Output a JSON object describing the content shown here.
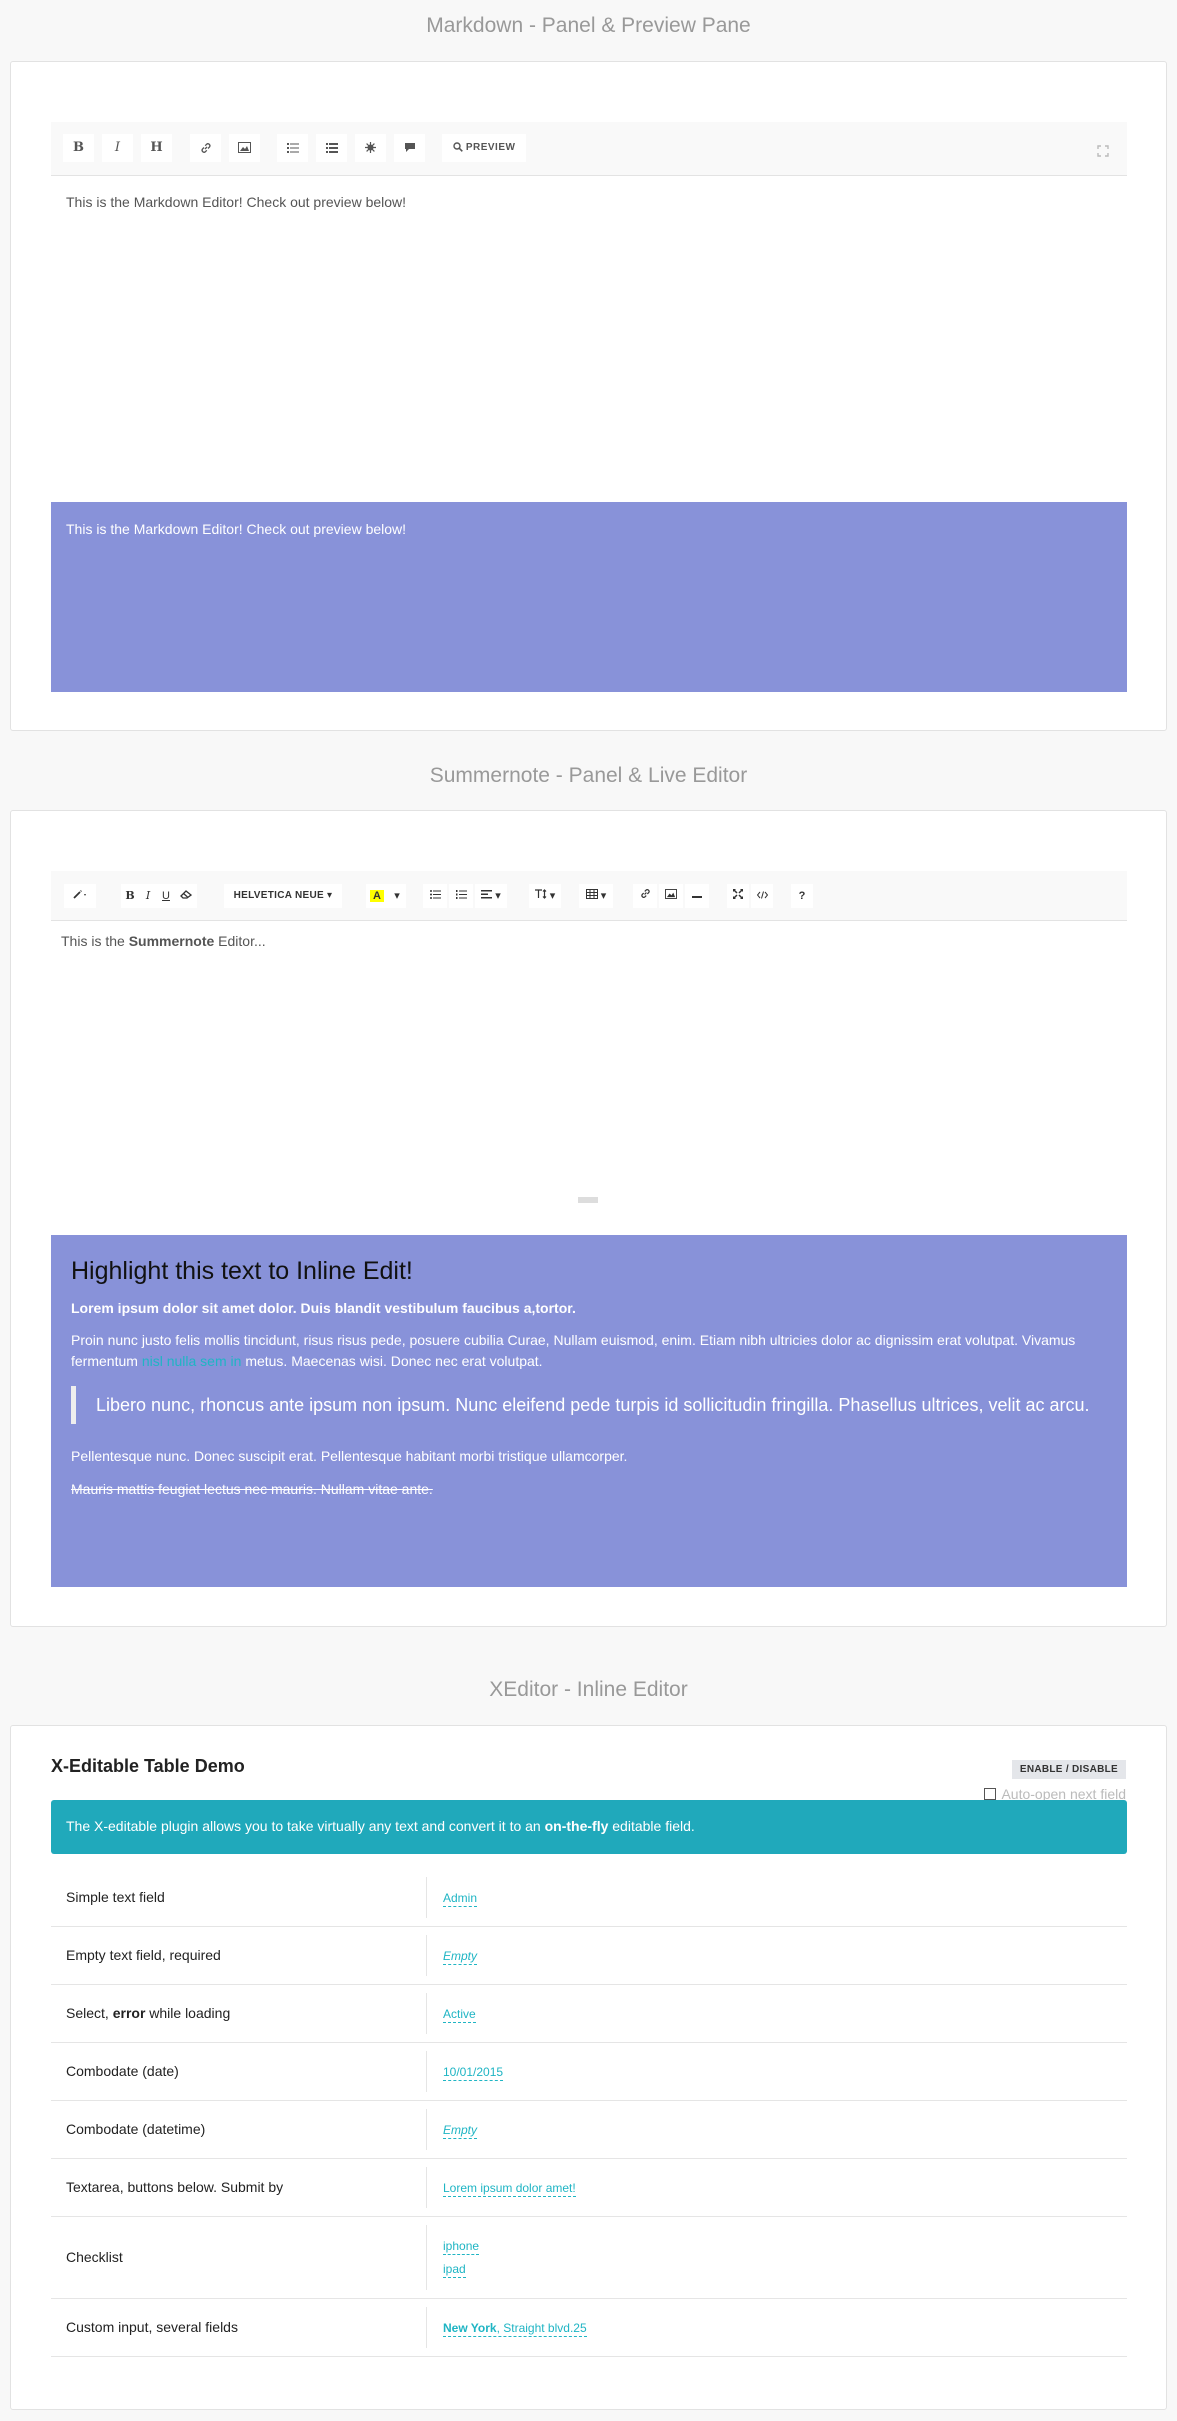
{
  "markdown": {
    "section_title": "Markdown - Panel & Preview Pane",
    "toolbar": {
      "bold": "B",
      "italic": "I",
      "heading": "H",
      "preview": "PREVIEW",
      "icons": [
        "link-icon",
        "image-icon",
        "unordered-list-icon",
        "ordered-list-icon",
        "code-icon",
        "quote-icon",
        "search-icon",
        "fullscreen-icon"
      ]
    },
    "editor_text": "This is the Markdown Editor! Check out preview below!",
    "preview_text": "This is the Markdown Editor! Check out preview below!",
    "preview_color": "#8892d9"
  },
  "summernote": {
    "section_title": "Summernote - Panel & Live Editor",
    "toolbar": {
      "font_name": "HELVETICA NEUE",
      "bold": "B",
      "italic": "I",
      "underline": "U",
      "color_letter": "A",
      "help": "?"
    },
    "editor_text_before": "This is the",
    "editor_text_bold": "Summernote",
    "editor_text_after": "Editor...",
    "live": {
      "heading": "Highlight this text to Inline Edit!",
      "bold_line": "Lorem ipsum dolor sit amet dolor. Duis blandit vestibulum faucibus a,tortor.",
      "para1_start": "Proin nunc justo felis mollis tincidunt, risus risus pede, posuere cubilia Curae, Nullam euismod, enim. Etiam nibh ultricies dolor ac dignissim erat volutpat. Vivamus fermentum",
      "para1_link": "nisl nulla sem in",
      "para1_end": "metus. Maecenas wisi. Donec nec erat volutpat.",
      "quote": "Libero nunc, rhoncus ante ipsum non ipsum. Nunc eleifend pede turpis id sollicitudin fringilla. Phasellus ultrices, velit ac arcu.",
      "para2": "Pellentesque nunc. Donec suscipit erat. Pellentesque habitant morbi tristique ullamcorper.",
      "para3": "Mauris mattis feugiat lectus nec mauris. Nullam vitae ante."
    }
  },
  "xeditor": {
    "section_title": "XEditor - Inline Editor",
    "title": "X-Editable Table Demo",
    "toggle_label": "ENABLE / DISABLE",
    "autoopen_label": "Auto-open next field",
    "alert_before": "The X-editable plugin allows you to take virtually any text and convert it to an",
    "alert_bold": "on-the-fly",
    "alert_after": "editable field.",
    "accent_color": "#20a9bb",
    "rows": [
      {
        "label": "Simple text field",
        "value": "Admin"
      },
      {
        "label": "Empty text field, required",
        "value": "Empty"
      },
      {
        "label_before": "Select,",
        "label_bold": "error",
        "label_after": "while loading",
        "value": "Active"
      },
      {
        "label": "Combodate (date)",
        "value": "10/01/2015"
      },
      {
        "label": "Combodate (datetime)",
        "value": "Empty"
      },
      {
        "label": "Textarea, buttons below. Submit by",
        "value": "Lorem ipsum dolor amet!"
      },
      {
        "label": "Checklist",
        "values": [
          "iphone",
          "ipad"
        ]
      },
      {
        "label": "Custom input, several fields",
        "value_bold": "New York",
        "value_rest": ", Straight blvd.25"
      }
    ]
  }
}
